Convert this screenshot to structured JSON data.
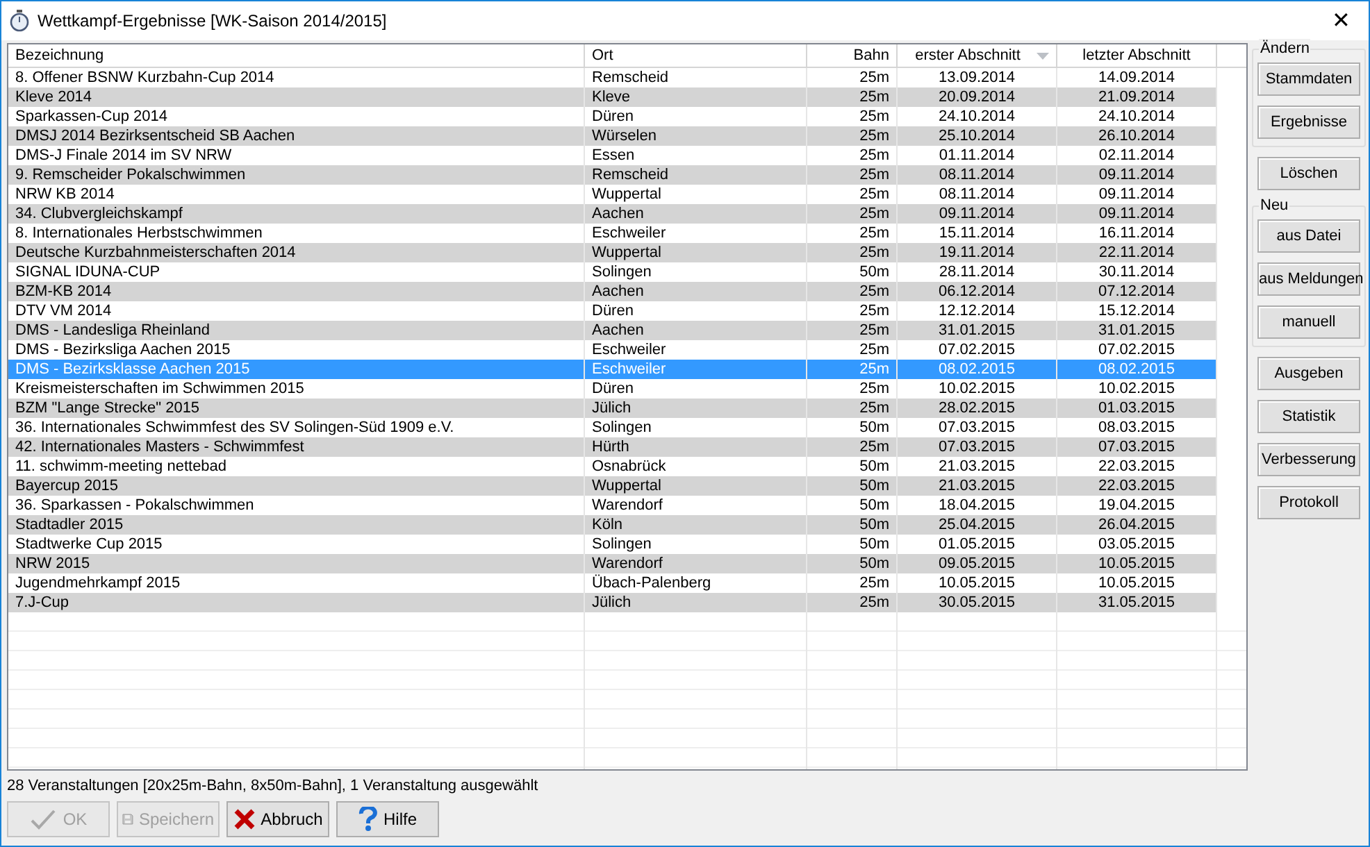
{
  "window": {
    "title": "Wettkampf-Ergebnisse [WK-Saison 2014/2015]",
    "close": "✕"
  },
  "table": {
    "columns": [
      {
        "label": "Bezeichnung",
        "sorted": false
      },
      {
        "label": "Ort",
        "sorted": false
      },
      {
        "label": "Bahn",
        "sorted": false
      },
      {
        "label": "erster Abschnitt",
        "sorted": true
      },
      {
        "label": "letzter Abschnitt",
        "sorted": false
      }
    ],
    "rows": [
      {
        "cells": [
          "8. Offener BSNW Kurzbahn-Cup 2014",
          "Remscheid",
          "25m",
          "13.09.2014",
          "14.09.2014"
        ],
        "selected": false
      },
      {
        "cells": [
          "Kleve 2014",
          "Kleve",
          "25m",
          "20.09.2014",
          "21.09.2014"
        ],
        "selected": false
      },
      {
        "cells": [
          "Sparkassen-Cup 2014",
          "Düren",
          "25m",
          "24.10.2014",
          "24.10.2014"
        ],
        "selected": false
      },
      {
        "cells": [
          "DMSJ 2014 Bezirksentscheid SB Aachen",
          "Würselen",
          "25m",
          "25.10.2014",
          "26.10.2014"
        ],
        "selected": false
      },
      {
        "cells": [
          "DMS-J Finale 2014 im SV NRW",
          "Essen",
          "25m",
          "01.11.2014",
          "02.11.2014"
        ],
        "selected": false
      },
      {
        "cells": [
          "9. Remscheider Pokalschwimmen",
          "Remscheid",
          "25m",
          "08.11.2014",
          "09.11.2014"
        ],
        "selected": false
      },
      {
        "cells": [
          "NRW KB 2014",
          "Wuppertal",
          "25m",
          "08.11.2014",
          "09.11.2014"
        ],
        "selected": false
      },
      {
        "cells": [
          "34. Clubvergleichskampf",
          "Aachen",
          "25m",
          "09.11.2014",
          "09.11.2014"
        ],
        "selected": false
      },
      {
        "cells": [
          "8. Internationales Herbstschwimmen",
          "Eschweiler",
          "25m",
          "15.11.2014",
          "16.11.2014"
        ],
        "selected": false
      },
      {
        "cells": [
          "Deutsche Kurzbahnmeisterschaften 2014",
          "Wuppertal",
          "25m",
          "19.11.2014",
          "22.11.2014"
        ],
        "selected": false
      },
      {
        "cells": [
          "SIGNAL IDUNA-CUP",
          "Solingen",
          "50m",
          "28.11.2014",
          "30.11.2014"
        ],
        "selected": false
      },
      {
        "cells": [
          "BZM-KB 2014",
          "Aachen",
          "25m",
          "06.12.2014",
          "07.12.2014"
        ],
        "selected": false
      },
      {
        "cells": [
          "DTV VM 2014",
          "Düren",
          "25m",
          "12.12.2014",
          "15.12.2014"
        ],
        "selected": false
      },
      {
        "cells": [
          "DMS - Landesliga Rheinland",
          "Aachen",
          "25m",
          "31.01.2015",
          "31.01.2015"
        ],
        "selected": false
      },
      {
        "cells": [
          "DMS - Bezirksliga Aachen 2015",
          "Eschweiler",
          "25m",
          "07.02.2015",
          "07.02.2015"
        ],
        "selected": false
      },
      {
        "cells": [
          "DMS - Bezirksklasse Aachen 2015",
          "Eschweiler",
          "25m",
          "08.02.2015",
          "08.02.2015"
        ],
        "selected": true
      },
      {
        "cells": [
          "Kreismeisterschaften im Schwimmen 2015",
          "Düren",
          "25m",
          "10.02.2015",
          "10.02.2015"
        ],
        "selected": false
      },
      {
        "cells": [
          "BZM \"Lange Strecke\" 2015",
          "Jülich",
          "25m",
          "28.02.2015",
          "01.03.2015"
        ],
        "selected": false
      },
      {
        "cells": [
          "36. Internationales Schwimmfest des SV Solingen-Süd 1909 e.V.",
          "Solingen",
          "50m",
          "07.03.2015",
          "08.03.2015"
        ],
        "selected": false
      },
      {
        "cells": [
          "42. Internationales Masters - Schwimmfest",
          "Hürth",
          "25m",
          "07.03.2015",
          "07.03.2015"
        ],
        "selected": false
      },
      {
        "cells": [
          "11. schwimm-meeting nettebad",
          "Osnabrück",
          "50m",
          "21.03.2015",
          "22.03.2015"
        ],
        "selected": false
      },
      {
        "cells": [
          "Bayercup 2015",
          "Wuppertal",
          "50m",
          "21.03.2015",
          "22.03.2015"
        ],
        "selected": false
      },
      {
        "cells": [
          "36. Sparkassen - Pokalschwimmen",
          "Warendorf",
          "50m",
          "18.04.2015",
          "19.04.2015"
        ],
        "selected": false
      },
      {
        "cells": [
          "Stadtadler 2015",
          "Köln",
          "50m",
          "25.04.2015",
          "26.04.2015"
        ],
        "selected": false
      },
      {
        "cells": [
          "Stadtwerke Cup 2015",
          "Solingen",
          "50m",
          "01.05.2015",
          "03.05.2015"
        ],
        "selected": false
      },
      {
        "cells": [
          "NRW 2015",
          "Warendorf",
          "50m",
          "09.05.2015",
          "10.05.2015"
        ],
        "selected": false
      },
      {
        "cells": [
          "Jugendmehrkampf 2015",
          "Übach-Palenberg",
          "25m",
          "10.05.2015",
          "10.05.2015"
        ],
        "selected": false
      },
      {
        "cells": [
          "7.J-Cup",
          "Jülich",
          "25m",
          "30.05.2015",
          "31.05.2015"
        ],
        "selected": false
      }
    ]
  },
  "side_panel": [
    {
      "kind": "group",
      "label": "Ändern",
      "buttons": [
        "Stammdaten",
        "Ergebnisse"
      ]
    },
    {
      "kind": "button",
      "label": "Löschen"
    },
    {
      "kind": "group",
      "label": "Neu",
      "buttons": [
        "aus Datei",
        "aus Meldungen",
        "manuell"
      ]
    },
    {
      "kind": "button",
      "label": "Ausgeben"
    },
    {
      "kind": "button",
      "label": "Statistik"
    },
    {
      "kind": "button",
      "label": "Verbesserung"
    },
    {
      "kind": "button",
      "label": "Protokoll"
    }
  ],
  "status_bar": "28 Veranstaltungen [20x25m-Bahn, 8x50m-Bahn], 1 Veranstaltung ausgewählt",
  "buttons": [
    {
      "label": "OK",
      "disabled": true
    },
    {
      "label": "Speichern",
      "disabled": true
    },
    {
      "label": "Abbruch",
      "disabled": false
    },
    {
      "label": "Hilfe",
      "disabled": false
    }
  ]
}
